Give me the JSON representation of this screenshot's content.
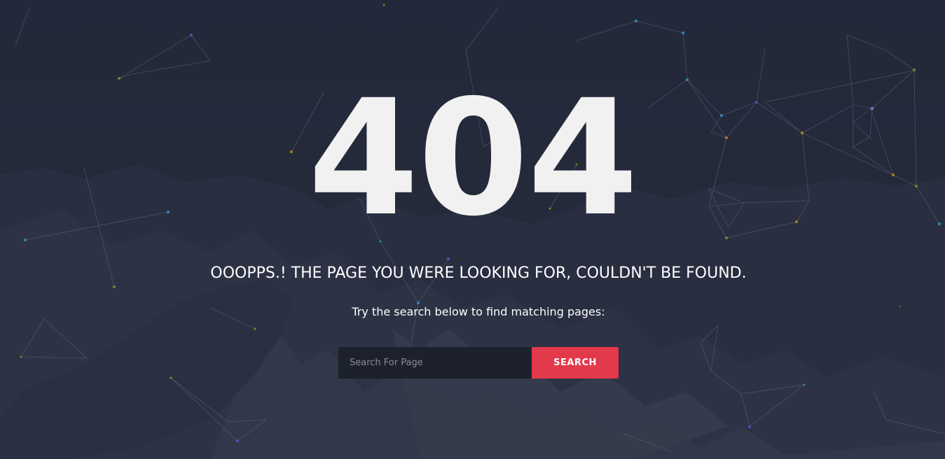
{
  "error": {
    "code": "404",
    "headline": "OOOPPS.! THE PAGE YOU WERE LOOKING FOR, COULDN'T BE FOUND.",
    "hint": "Try the search below to find matching pages:"
  },
  "search": {
    "placeholder": "Search For Page",
    "button_label": "SEARCH"
  },
  "colors": {
    "background": "#262b3a",
    "accent": "#e23a4b",
    "text": "#ffffff"
  }
}
